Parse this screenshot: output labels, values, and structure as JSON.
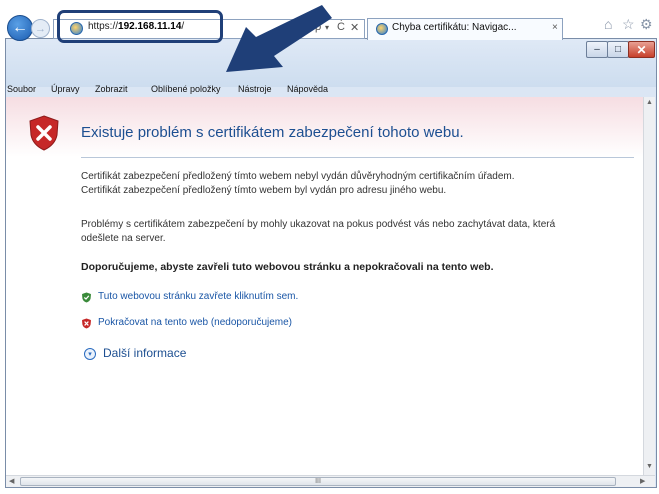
{
  "window": {
    "controls": {
      "minimize": "–",
      "maximize": "□",
      "close": "✕"
    }
  },
  "navigation": {
    "back_icon": "back-arrow-icon",
    "forward_icon": "forward-arrow-icon",
    "back_glyph": "←",
    "forward_glyph": "→"
  },
  "address_bar": {
    "protocol": "https://",
    "host": "192.168.11.14",
    "path": "/",
    "search_glyph": "ρ",
    "dropdown_glyph": "▾",
    "refresh_glyph": "Ċ",
    "stop_glyph": "✕"
  },
  "tab": {
    "title": "Chyba certifikátu: Navigac...",
    "close_glyph": "×"
  },
  "toolbar": {
    "home_glyph": "⌂",
    "favorites_glyph": "☆",
    "settings_glyph": "⚙"
  },
  "menu": {
    "items": [
      "Soubor",
      "Úpravy",
      "Zobrazit",
      "Oblíbené položky",
      "Nástroje",
      "Nápověda"
    ]
  },
  "error_page": {
    "headline": "Existuje problém s certifikátem zabezpečení tohoto webu.",
    "paragraph1_line1": "Certifikát zabezpečení předložený tímto webem nebyl vydán důvěryhodným certifikačním úřadem.",
    "paragraph1_line2": "Certifikát zabezpečení předložený tímto webem byl vydán pro adresu jiného webu.",
    "paragraph2_line1": "Problémy s certifikátem zabezpečení by mohly ukazovat na pokus podvést vás nebo zachytávat data, která",
    "paragraph2_line2": "odešlete na server.",
    "recommendation": "Doporučujeme, abyste zavřeli tuto webovou stránku a nepokračovali na tento web.",
    "option_close": "Tuto webovou stránku zavřete kliknutím sem.",
    "option_continue": "Pokračovat na tento web (nedoporučujeme)",
    "more_info": "Další informace",
    "more_glyph": "▾"
  },
  "scrollbars": {
    "up": "▲",
    "down": "▼",
    "left": "◀",
    "right": "▶",
    "grip": "III"
  },
  "colors": {
    "accent": "#1d4f91",
    "link": "#1a56a6",
    "error_red": "#c62828",
    "safe_green": "#3a8a3a",
    "callout": "#1f3f78"
  }
}
